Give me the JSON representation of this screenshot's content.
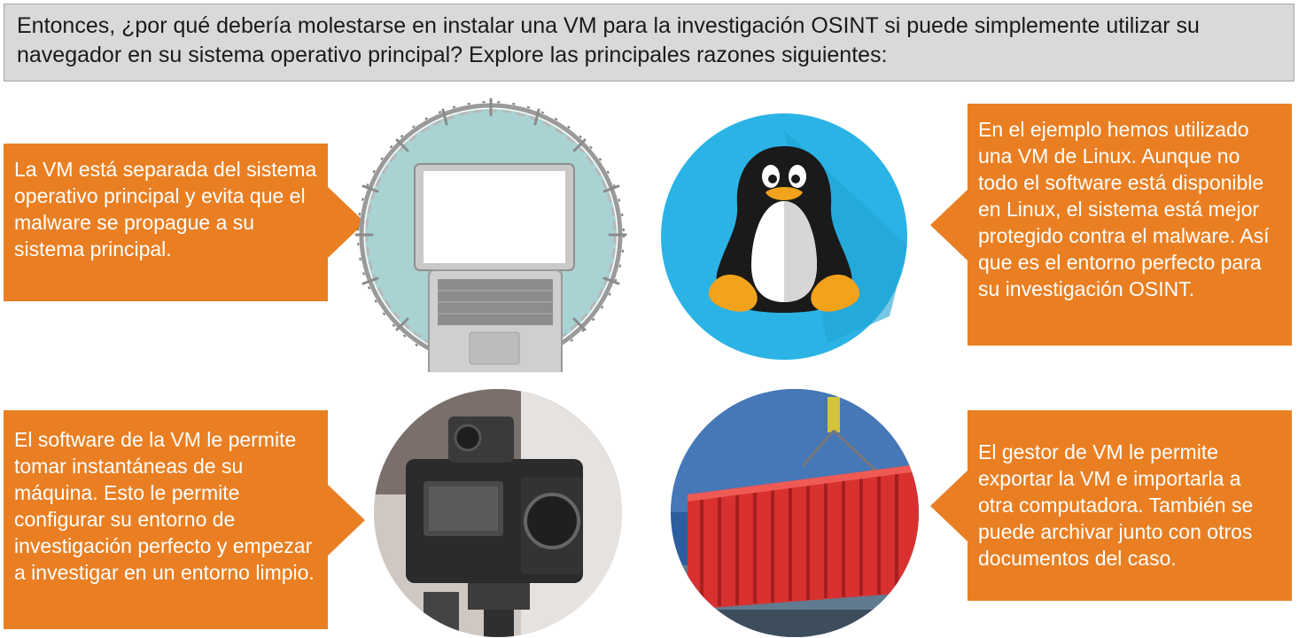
{
  "header": {
    "text": "Entonces, ¿por qué debería molestarse en instalar una VM para la investigación OSINT si puede simplemente utilizar su navegador en su sistema operativo principal? Explore las principales razones siguientes:"
  },
  "callouts": [
    {
      "text": "La VM está separada del sistema operativo principal y evita que el malware se propague a su sistema principal."
    },
    {
      "text": "En el ejemplo hemos utilizado una VM de Linux. Aunque no todo el software está disponible en Linux, el sistema está mejor protegido contra el malware. Así que es el entorno perfecto para su investigación OSINT."
    },
    {
      "text": "El software de la VM le permite tomar instantáneas de su máquina. Esto le permite configurar su entorno de investigación perfecto y empezar a investigar en un entorno limpio."
    },
    {
      "text": "El gestor de VM le permite exportar la VM e importarla a otra computadora. También se puede archivar junto con otros documentos del caso."
    }
  ],
  "images": [
    {
      "icon": "laptop-barbed-wire-icon"
    },
    {
      "icon": "linux-penguin-icon"
    },
    {
      "icon": "camera-icon"
    },
    {
      "icon": "shipping-container-icon"
    }
  ],
  "colors": {
    "callout": "#e97f22",
    "header_bg": "#d9d9d9",
    "penguin_bg": "#2bb3e6"
  }
}
